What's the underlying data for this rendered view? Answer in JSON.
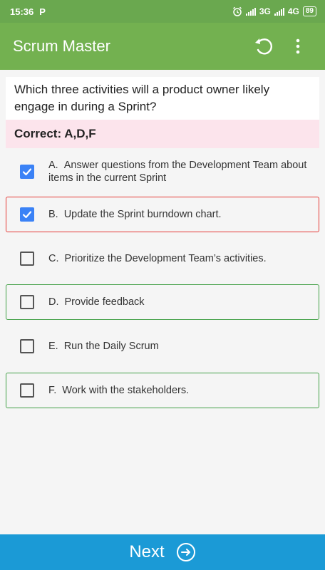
{
  "status_bar": {
    "time": "15:36",
    "app_badge": "P",
    "network_1": "3G",
    "network_2": "4G",
    "battery": "89"
  },
  "app_bar": {
    "title": "Scrum Master",
    "undo_icon": "undo-icon",
    "menu_icon": "more-vert-icon"
  },
  "question": {
    "text": "Which three activities will a product owner likely engage in during a Sprint?"
  },
  "answer": {
    "text": "Correct: A,D,F"
  },
  "options": [
    {
      "letter": "A.",
      "text": "Answer questions from the Development Team about items in the current Sprint",
      "checked": true,
      "state": "none"
    },
    {
      "letter": "B.",
      "text": "Update the Sprint burndown chart.",
      "checked": true,
      "state": "wrong"
    },
    {
      "letter": "C.",
      "text": "Prioritize the Development Team’s activities.",
      "checked": false,
      "state": "none"
    },
    {
      "letter": "D.",
      "text": "Provide feedback",
      "checked": false,
      "state": "correct"
    },
    {
      "letter": "E.",
      "text": "Run the Daily Scrum",
      "checked": false,
      "state": "none"
    },
    {
      "letter": "F.",
      "text": "Work with the stakeholders.",
      "checked": false,
      "state": "correct"
    }
  ],
  "footer": {
    "next_label": "Next",
    "next_icon": "arrow-circle-right-icon"
  },
  "colors": {
    "status_green": "#6aa84f",
    "appbar_green": "#73b150",
    "correct_bg": "#fce4ec",
    "wrong_border": "#e53935",
    "right_border": "#43a047",
    "check_blue": "#3b82f6",
    "next_blue": "#1b9ad6"
  }
}
